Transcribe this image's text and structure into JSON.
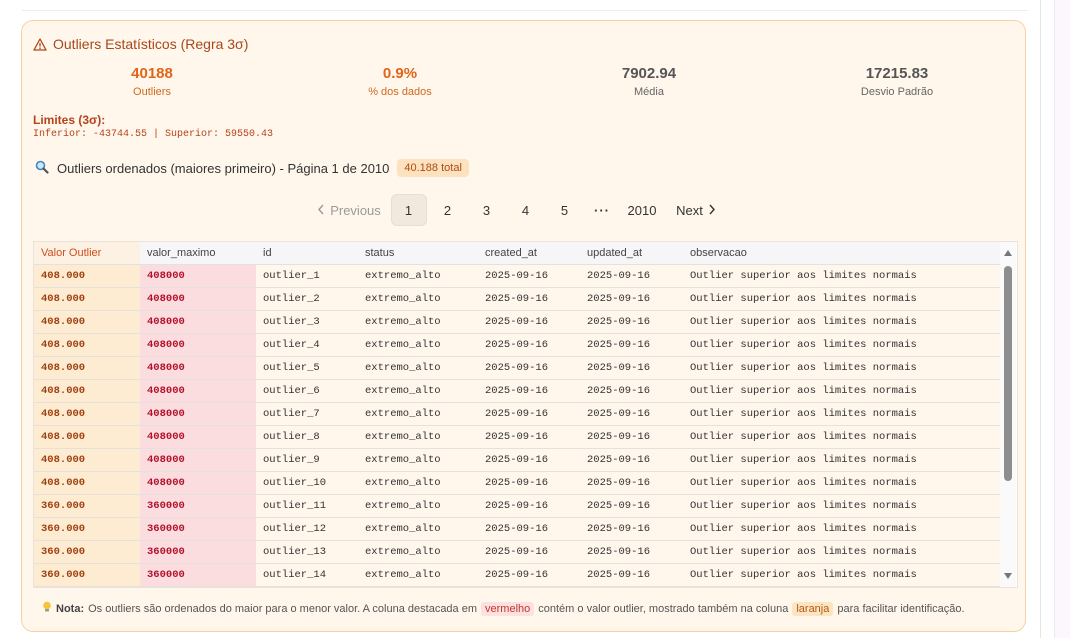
{
  "card": {
    "title": "Outliers Estatísticos (Regra 3σ)",
    "stats": [
      {
        "value": "40188",
        "label": "Outliers"
      },
      {
        "value": "0.9%",
        "label": "% dos dados"
      },
      {
        "value": "7902.94",
        "label": "Média"
      },
      {
        "value": "17215.83",
        "label": "Desvio Padrão"
      }
    ],
    "limits_title": "Limites (3σ):",
    "limits_text": "Inferior: -43744.55 | Superior: 59550.43"
  },
  "list": {
    "title": "Outliers ordenados (maiores primeiro) - Página 1 de 2010",
    "total_badge": "40.188 total"
  },
  "pagination": {
    "previous": "Previous",
    "pages": [
      "1",
      "2",
      "3",
      "4",
      "5"
    ],
    "ellipsis": "···",
    "last": "2010",
    "next": "Next",
    "current": "1"
  },
  "table": {
    "columns": [
      "Valor Outlier",
      "valor_maximo",
      "id",
      "status",
      "created_at",
      "updated_at",
      "observacao"
    ],
    "rows": [
      [
        "408.000",
        "408000",
        "outlier_1",
        "extremo_alto",
        "2025-09-16",
        "2025-09-16",
        "Outlier superior aos limites normais"
      ],
      [
        "408.000",
        "408000",
        "outlier_2",
        "extremo_alto",
        "2025-09-16",
        "2025-09-16",
        "Outlier superior aos limites normais"
      ],
      [
        "408.000",
        "408000",
        "outlier_3",
        "extremo_alto",
        "2025-09-16",
        "2025-09-16",
        "Outlier superior aos limites normais"
      ],
      [
        "408.000",
        "408000",
        "outlier_4",
        "extremo_alto",
        "2025-09-16",
        "2025-09-16",
        "Outlier superior aos limites normais"
      ],
      [
        "408.000",
        "408000",
        "outlier_5",
        "extremo_alto",
        "2025-09-16",
        "2025-09-16",
        "Outlier superior aos limites normais"
      ],
      [
        "408.000",
        "408000",
        "outlier_6",
        "extremo_alto",
        "2025-09-16",
        "2025-09-16",
        "Outlier superior aos limites normais"
      ],
      [
        "408.000",
        "408000",
        "outlier_7",
        "extremo_alto",
        "2025-09-16",
        "2025-09-16",
        "Outlier superior aos limites normais"
      ],
      [
        "408.000",
        "408000",
        "outlier_8",
        "extremo_alto",
        "2025-09-16",
        "2025-09-16",
        "Outlier superior aos limites normais"
      ],
      [
        "408.000",
        "408000",
        "outlier_9",
        "extremo_alto",
        "2025-09-16",
        "2025-09-16",
        "Outlier superior aos limites normais"
      ],
      [
        "408.000",
        "408000",
        "outlier_10",
        "extremo_alto",
        "2025-09-16",
        "2025-09-16",
        "Outlier superior aos limites normais"
      ],
      [
        "360.000",
        "360000",
        "outlier_11",
        "extremo_alto",
        "2025-09-16",
        "2025-09-16",
        "Outlier superior aos limites normais"
      ],
      [
        "360.000",
        "360000",
        "outlier_12",
        "extremo_alto",
        "2025-09-16",
        "2025-09-16",
        "Outlier superior aos limites normais"
      ],
      [
        "360.000",
        "360000",
        "outlier_13",
        "extremo_alto",
        "2025-09-16",
        "2025-09-16",
        "Outlier superior aos limites normais"
      ],
      [
        "360.000",
        "360000",
        "outlier_14",
        "extremo_alto",
        "2025-09-16",
        "2025-09-16",
        "Outlier superior aos limites normais"
      ]
    ]
  },
  "note": {
    "label": "Nota:",
    "text_1": "Os outliers são ordenados do maior para o menor valor. A coluna destacada em",
    "chip_red": "vermelho",
    "text_2": "contém o valor outlier, mostrado também na coluna",
    "chip_orange": "laranja",
    "text_3": "para facilitar identificação."
  },
  "colors": {
    "accent_orange": "#e0641a",
    "title_brown": "#a8491a",
    "highlight_red": "#fbdcdf",
    "highlight_orange": "#fdebd2"
  },
  "icons": {
    "title": "warning-triangle-icon",
    "list": "magnifier-icon",
    "note": "lightbulb-icon",
    "previous": "chevron-left-icon",
    "next": "chevron-right-icon"
  }
}
